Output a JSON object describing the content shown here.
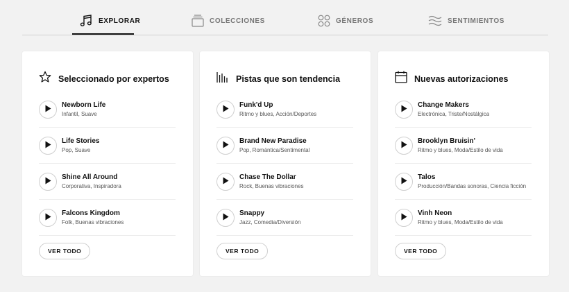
{
  "tabs": [
    {
      "label": "EXPLORAR",
      "icon": "music-note-icon",
      "active": true
    },
    {
      "label": "COLECCIONES",
      "icon": "collection-stack-icon"
    },
    {
      "label": "GÉNEROS",
      "icon": "four-circles-icon"
    },
    {
      "label": "SENTIMIENTOS",
      "icon": "waves-icon"
    }
  ],
  "cards": [
    {
      "title": "Seleccionado por expertos",
      "icon": "star-icon",
      "tracks": [
        {
          "title": "Newborn Life",
          "tags": "Infantil, Suave"
        },
        {
          "title": "Life Stories",
          "tags": "Pop, Suave"
        },
        {
          "title": "Shine All Around",
          "tags": "Corporativa, Inspiradora"
        },
        {
          "title": "Falcons Kingdom",
          "tags": "Folk, Buenas vibraciones"
        }
      ],
      "see_all": "VER TODO"
    },
    {
      "title": "Pistas que son tendencia",
      "icon": "trending-bars-icon",
      "tracks": [
        {
          "title": "Funk'd Up",
          "tags": "Ritmo y blues, Acción/Deportes"
        },
        {
          "title": "Brand New Paradise",
          "tags": "Pop, Romántica/Sentimental"
        },
        {
          "title": "Chase The Dollar",
          "tags": "Rock, Buenas vibraciones"
        },
        {
          "title": "Snappy",
          "tags": "Jazz, Comedia/Diversión"
        }
      ],
      "see_all": "VER TODO"
    },
    {
      "title": "Nuevas autorizaciones",
      "icon": "calendar-icon",
      "tracks": [
        {
          "title": "Change Makers",
          "tags": "Electrónica, Triste/Nostálgica"
        },
        {
          "title": "Brooklyn Bruisin'",
          "tags": "Ritmo y blues, Moda/Estilo de vida"
        },
        {
          "title": "Talos",
          "tags": "Producción/Bandas sonoras, Ciencia ficción"
        },
        {
          "title": "Vinh Neon",
          "tags": "Ritmo y blues, Moda/Estilo de vida"
        }
      ],
      "see_all": "VER TODO"
    }
  ]
}
